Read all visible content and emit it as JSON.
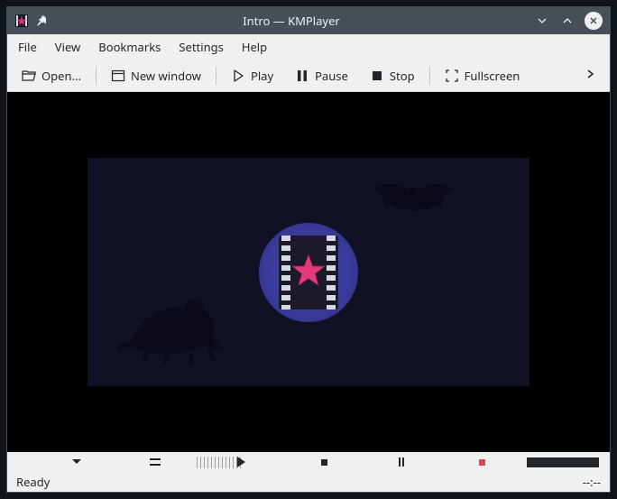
{
  "window": {
    "title": "Intro — KMPlayer"
  },
  "menu": {
    "file": "File",
    "view": "View",
    "bookmarks": "Bookmarks",
    "settings": "Settings",
    "help": "Help"
  },
  "toolbar": {
    "open": "Open...",
    "new_window": "New window",
    "play": "Play",
    "pause": "Pause",
    "stop": "Stop",
    "fullscreen": "Fullscreen"
  },
  "status": {
    "left": "Ready",
    "right": "--:--"
  }
}
